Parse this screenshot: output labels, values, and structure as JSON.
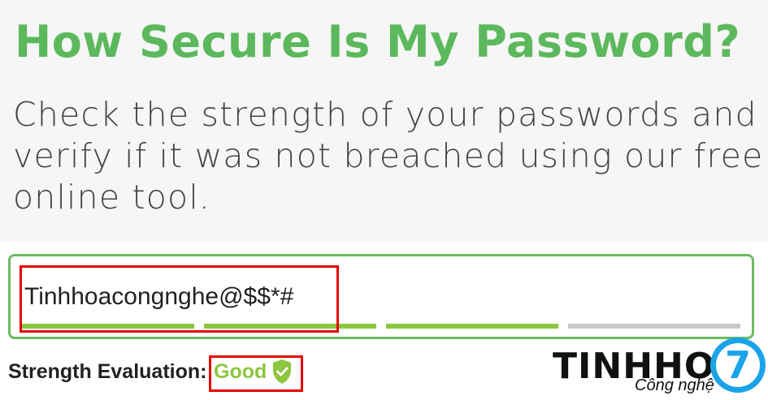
{
  "hero": {
    "title": "How Secure Is My Password?",
    "description_lines": [
      "Check the strength of your passwords and",
      "verify if it was not breached using our free",
      "online tool."
    ]
  },
  "password": {
    "value": "Tinhhoacongnghe@$$*#",
    "meter": [
      {
        "filled": true,
        "color": "#8dc63f"
      },
      {
        "filled": true,
        "color": "#8dc63f"
      },
      {
        "filled": true,
        "color": "#8dc63f"
      },
      {
        "filled": false,
        "color": "#c8c8c8"
      }
    ]
  },
  "strength": {
    "label": "Strength Evaluation:",
    "value": "Good",
    "color": "#8dc63f",
    "icon": "shield-check-icon"
  },
  "logo": {
    "name": "TINHHOA",
    "tagline": "Công nghệ",
    "badge_glyph": "7",
    "badge_color": "#1aa3e8"
  },
  "colors": {
    "title_green": "#5cb85c",
    "box_border": "#6dbb63",
    "highlight_red": "#e60000"
  }
}
